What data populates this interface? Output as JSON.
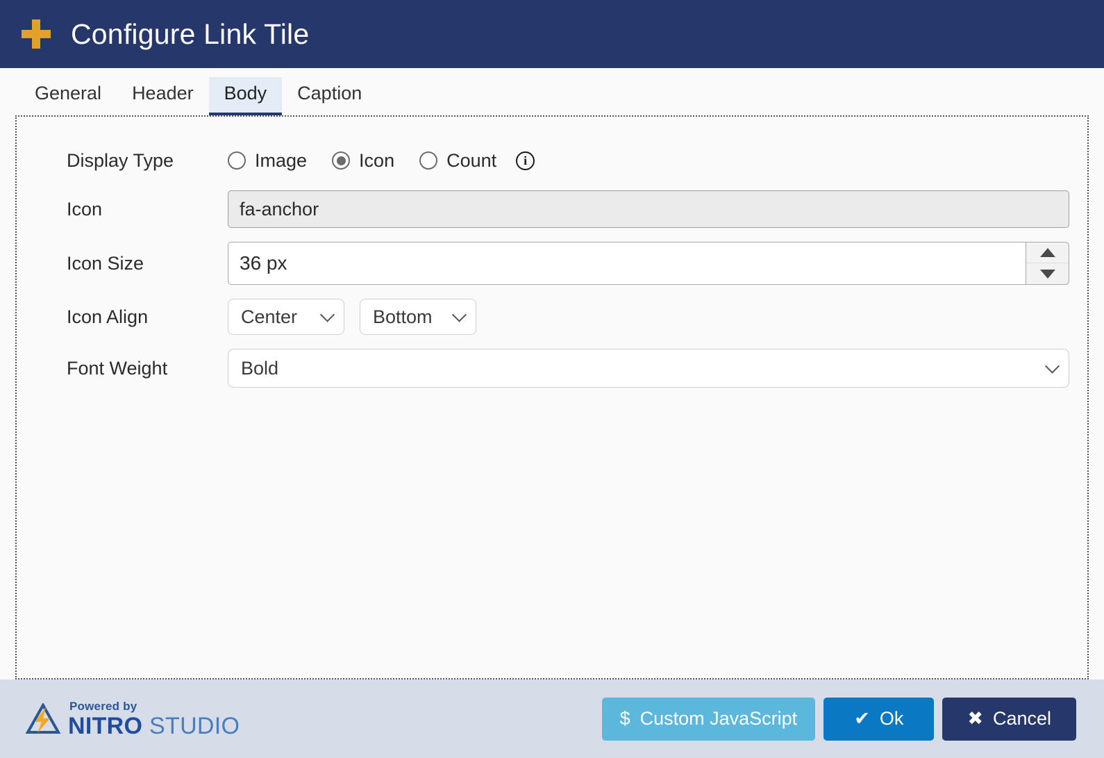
{
  "titlebar": {
    "icon": "plus-icon",
    "title": "Configure Link Tile"
  },
  "tabs": [
    {
      "label": "General",
      "active": false
    },
    {
      "label": "Header",
      "active": false
    },
    {
      "label": "Body",
      "active": true
    },
    {
      "label": "Caption",
      "active": false
    }
  ],
  "form": {
    "display_type": {
      "label": "Display Type",
      "options": [
        {
          "label": "Image",
          "selected": false
        },
        {
          "label": "Icon",
          "selected": true
        },
        {
          "label": "Count",
          "selected": false
        }
      ],
      "info_icon": "info-icon"
    },
    "icon": {
      "label": "Icon",
      "value": "fa-anchor",
      "readonly": true
    },
    "icon_size": {
      "label": "Icon Size",
      "value": "36 px",
      "spinner_up": "increment-icon",
      "spinner_down": "decrement-icon"
    },
    "icon_align": {
      "label": "Icon Align",
      "horizontal": "Center",
      "vertical": "Bottom"
    },
    "font_weight": {
      "label": "Font Weight",
      "value": "Bold"
    }
  },
  "footer": {
    "logo": {
      "powered_by": "Powered by",
      "brand_primary": "NITRO",
      "brand_secondary": "STUDIO"
    },
    "buttons": {
      "custom_js": {
        "label": "Custom JavaScript",
        "glyph": "$",
        "color": "#5bb8dc"
      },
      "ok": {
        "label": "Ok",
        "glyph": "✔",
        "color": "#0b78c4"
      },
      "cancel": {
        "label": "Cancel",
        "glyph": "✖",
        "color": "#26386b"
      }
    }
  },
  "colors": {
    "header_navy": "#26386b",
    "accent_gold": "#e0a229",
    "active_tab_bg": "#e3ecf7",
    "footer_bg": "#d6dce8"
  }
}
